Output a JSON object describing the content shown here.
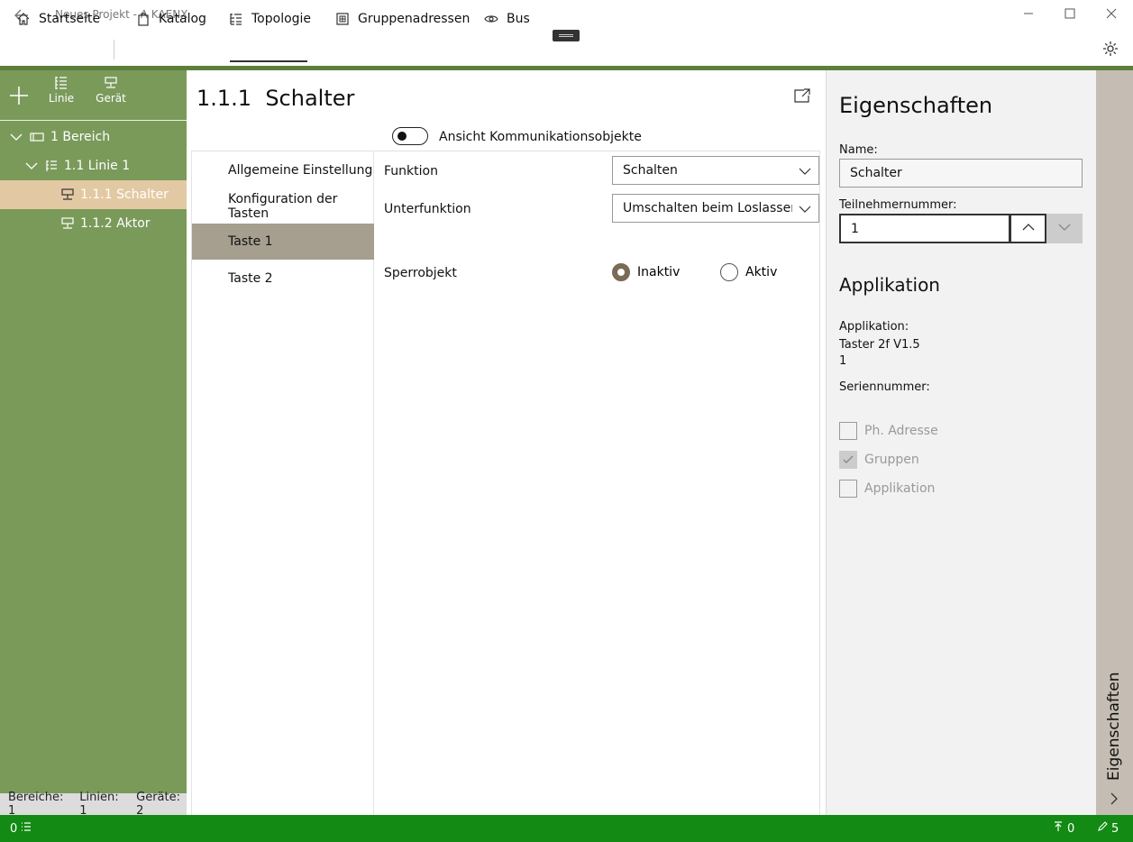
{
  "window": {
    "title": "Neues Projekt - A KAENX"
  },
  "nav": {
    "items": [
      {
        "label": "Startseite",
        "icon": "home-icon"
      },
      {
        "label": "Katalog",
        "icon": "catalog-icon"
      },
      {
        "label": "Topologie",
        "icon": "topology-icon",
        "selected": true
      },
      {
        "label": "Gruppenadressen",
        "icon": "group-address-icon"
      },
      {
        "label": "Bus",
        "icon": "bus-icon"
      }
    ]
  },
  "sidebar": {
    "toolbar": {
      "add_label": "",
      "line_label": "Linie",
      "device_label": "Gerät"
    },
    "tree": [
      {
        "label": "1 Bereich",
        "level": 0
      },
      {
        "label": "1.1 Linie 1",
        "level": 1
      },
      {
        "label": "1.1.1 Schalter",
        "level": 2,
        "selected": true
      },
      {
        "label": "1.1.2 Aktor",
        "level": 2
      }
    ],
    "status": {
      "areas": "Bereiche: 1",
      "lines": "Linien: 1",
      "devices": "Geräte: 2"
    }
  },
  "center": {
    "title": "1.1.1  Schalter",
    "toggle_label": "Ansicht Kommunikationsobjekte",
    "param_groups": [
      {
        "label": "Allgemeine Einstellung"
      },
      {
        "label": "Konfiguration der Tasten"
      },
      {
        "label": "Taste 1",
        "selected": true
      },
      {
        "label": "Taste 2"
      }
    ],
    "params": {
      "funktion_label": "Funktion",
      "funktion_value": "Schalten",
      "unterfunktion_label": "Unterfunktion",
      "unterfunktion_value": "Umschalten beim Loslassen de",
      "sperrobjekt_label": "Sperrobjekt",
      "option_inactive": "Inaktiv",
      "option_active": "Aktiv"
    }
  },
  "properties": {
    "title": "Eigenschaften",
    "name_label": "Name:",
    "name_value": "Schalter",
    "tn_label": "Teilnehmernummer:",
    "tn_value": "1",
    "app_heading": "Applikation",
    "app_label": "Applikation:",
    "app_name": "Taster 2f V1.5",
    "app_version": "1",
    "serial_label": "Seriennummer:",
    "checkboxes": [
      {
        "label": "Ph. Adresse",
        "checked": false
      },
      {
        "label": "Gruppen",
        "checked": true
      },
      {
        "label": "Applikation",
        "checked": false
      }
    ],
    "collapse_label": "Eigenschaften"
  },
  "statusbar": {
    "left_count": "0",
    "upload_count": "0",
    "edit_count": "5"
  }
}
